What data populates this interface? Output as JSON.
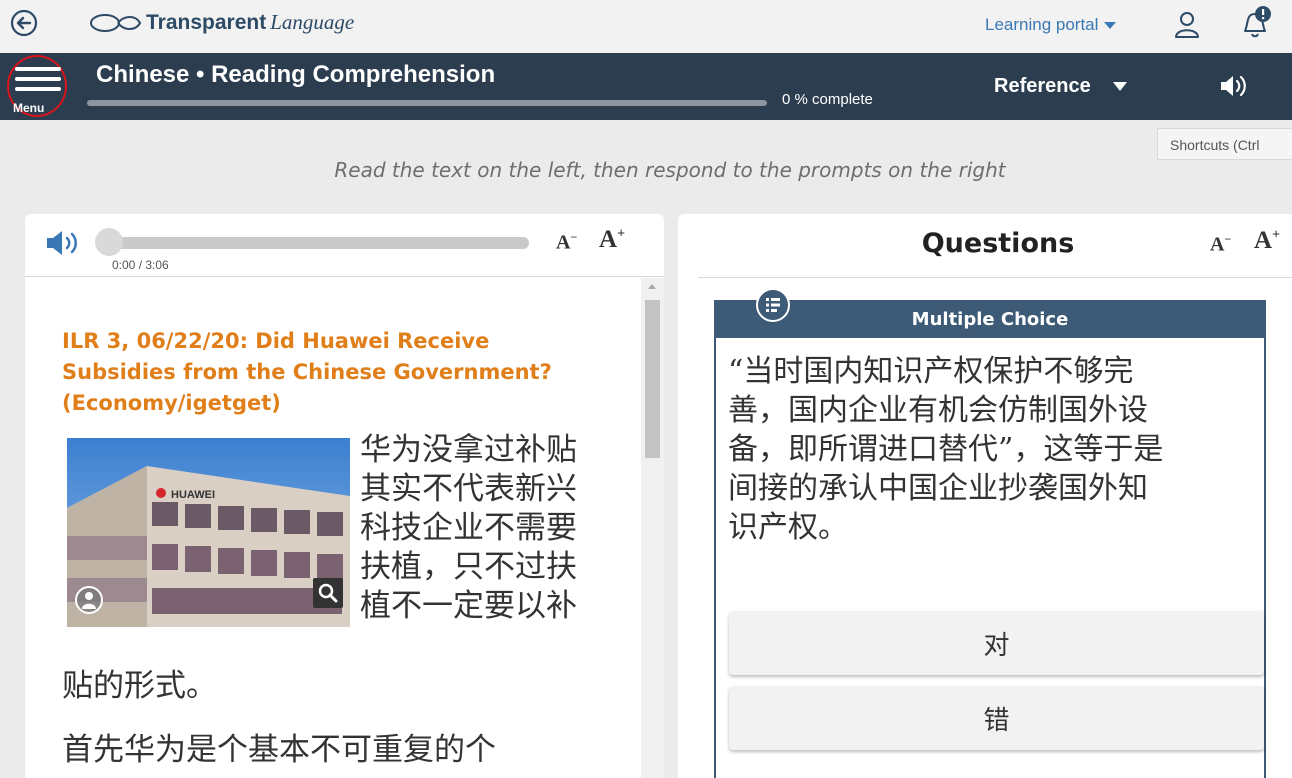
{
  "topbar": {
    "logo_bold": "Transparent",
    "logo_italic": "Language",
    "portal_label": "Learning portal"
  },
  "navbar": {
    "menu_label": "Menu",
    "course_title": "Chinese • Reading Comprehension",
    "progress_text": "0 % complete",
    "progress_value": 0,
    "reference_label": "Reference"
  },
  "shortcuts_label": "Shortcuts (Ctrl",
  "instruction": "Read the text on the left, then respond to the prompts on the right",
  "reading": {
    "audio_time": "0:00 / 3:06",
    "font_decrease": "A",
    "font_increase": "A",
    "title_line1": "ILR 3, 06/22/20: Did Huawei Receive",
    "title_line2": "Subsidies from the Chinese Government?",
    "title_line3": "(Economy/igetget)",
    "image_sign": "HUAWEI",
    "text_lines": [
      "华为没拿过补贴",
      "其实不代表新兴",
      "科技企业不需要",
      "扶植，只不过扶",
      "植不一定要以补"
    ],
    "text_tail": "贴的形式。",
    "text_para2": "首先华为是个基本不可重复的个"
  },
  "questions": {
    "title": "Questions",
    "font_decrease": "A",
    "font_increase": "A",
    "type_label": "Multiple Choice",
    "prompt_lines": [
      "“当时国内知识产权保护不够完",
      "善，国内企业有机会仿制国外设",
      "备，即所谓进口替代”，这等于是",
      "间接的承认中国企业抄袭国外知",
      "识产权。"
    ],
    "answers": [
      "对",
      "错"
    ]
  },
  "colors": {
    "navbar": "#2b3d4f",
    "accent_orange": "#e07f1a",
    "card_header": "#3d5a76",
    "link_blue": "#3a78b5",
    "highlight_circle": "#d9141b"
  },
  "icons": [
    "back-arrow-icon",
    "user-icon",
    "bell-notification-icon",
    "hamburger-menu-icon",
    "speaker-icon",
    "list-icon",
    "person-icon",
    "zoom-icon"
  ]
}
